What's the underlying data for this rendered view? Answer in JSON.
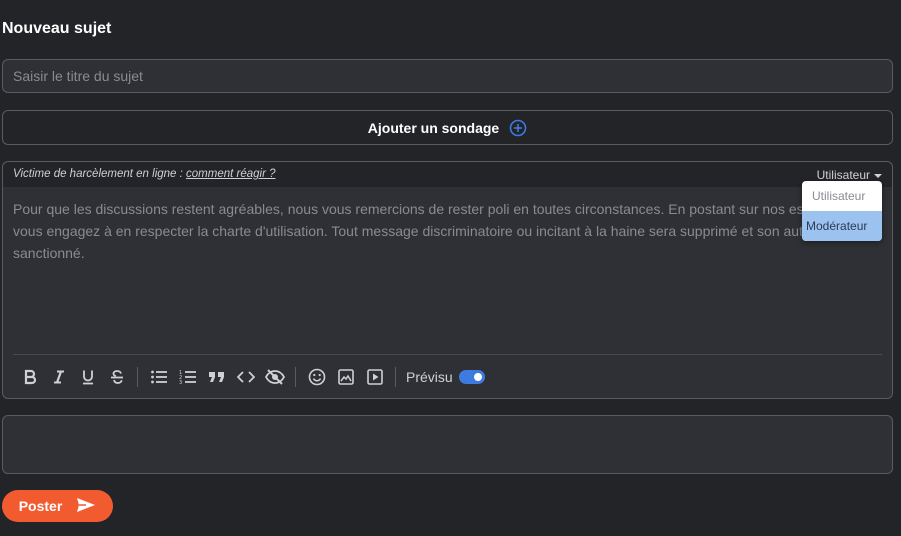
{
  "header": {
    "title": "Nouveau sujet"
  },
  "subject": {
    "placeholder": "Saisir le titre du sujet",
    "value": ""
  },
  "poll": {
    "label": "Ajouter un sondage",
    "icon": "plus-circle-icon",
    "icon_color": "#3d7be0"
  },
  "editor": {
    "harassment_text": "Victime de harcèlement en ligne : ",
    "harassment_link": "comment réagir ?",
    "role_selected": "Utilisateur",
    "body_text": "Pour que les discussions restent agréables, nous vous remercions de rester poli en toutes circonstances. En postant sur nos espaces, vous vous engagez à en respecter la charte d'utilisation. Tout message discriminatoire ou incitant à la haine sera supprimé et son auteur sanctionné.",
    "toolbar": {
      "buttons": [
        "bold-icon",
        "italic-icon",
        "underline-icon",
        "strikethrough-icon",
        "bullet-list-icon",
        "numbered-list-icon",
        "quote-icon",
        "code-icon",
        "spoiler-icon",
        "emoji-icon",
        "image-icon",
        "video-icon"
      ],
      "preview_label": "Prévisu",
      "preview_enabled": true
    }
  },
  "role_dropdown": {
    "options": [
      {
        "label": "Utilisateur",
        "selected": false
      },
      {
        "label": "Modérateur",
        "selected": true
      }
    ]
  },
  "post": {
    "label": "Poster",
    "icon": "send-icon",
    "color": "#f25a30"
  }
}
